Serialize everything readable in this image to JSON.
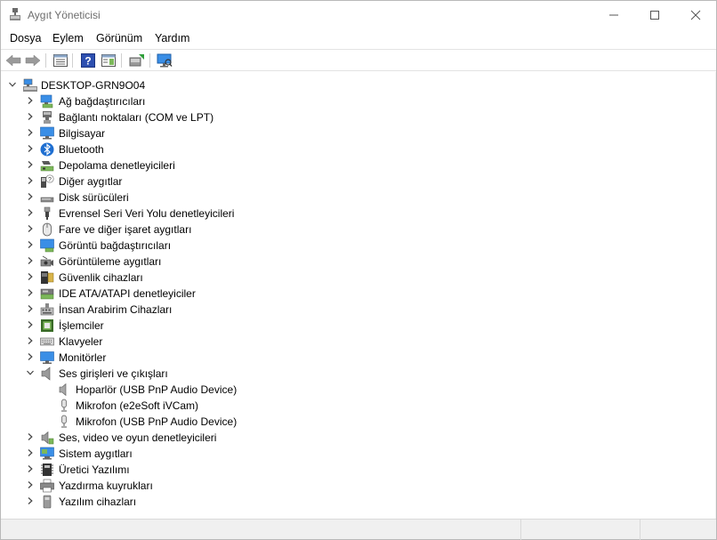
{
  "window": {
    "title": "Aygıt Yöneticisi",
    "controls": [
      "minimize",
      "maximize",
      "close"
    ]
  },
  "menu": {
    "items": [
      "Dosya",
      "Eylem",
      "Görünüm",
      "Yardım"
    ]
  },
  "toolbar": {
    "buttons": [
      "back-icon",
      "forward-icon",
      "properties-list-icon",
      "help-icon",
      "action-pane-icon",
      "update-driver-icon",
      "scan-hardware-icon"
    ]
  },
  "tree": {
    "root": "DESKTOP-GRN9O04",
    "categories": [
      "Ağ bağdaştırıcıları",
      "Bağlantı noktaları (COM ve LPT)",
      "Bilgisayar",
      "Bluetooth",
      "Depolama denetleyicileri",
      "Diğer aygıtlar",
      "Disk sürücüleri",
      "Evrensel Seri Veri Yolu denetleyicileri",
      "Fare ve diğer işaret aygıtları",
      "Görüntü bağdaştırıcıları",
      "Görüntüleme aygıtları",
      "Güvenlik cihazları",
      "IDE ATA/ATAPI denetleyiciler",
      "İnsan Arabirim Cihazları",
      "İşlemciler",
      "Klavyeler",
      "Monitörler",
      "Ses girişleri ve çıkışları",
      "Ses, video ve oyun denetleyicileri",
      "Sistem aygıtları",
      "Üretici Yazılımı",
      "Yazdırma kuyrukları",
      "Yazılım cihazları"
    ],
    "expanded_children": [
      "Hoparlör (USB PnP Audio Device)",
      "Mikrofon (e2eSoft iVCam)",
      "Mikrofon (USB PnP Audio Device)"
    ]
  },
  "colors": {
    "accent": "#0078d4",
    "monitor_blue": "#3a8ee6",
    "menu_text": "#000000",
    "title_text": "#6d6d6d"
  }
}
